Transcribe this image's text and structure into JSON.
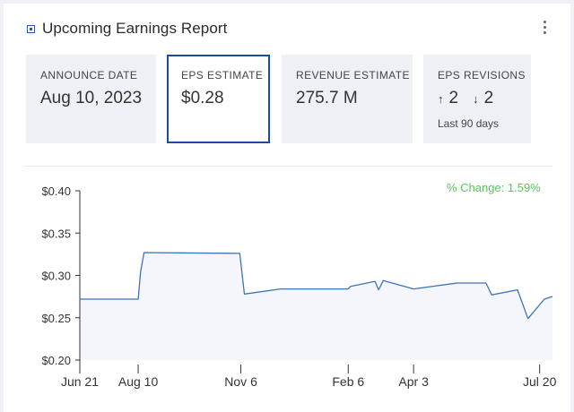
{
  "header": {
    "title": "Upcoming Earnings Report",
    "logo_icon": "square-logo-icon",
    "menu_icon": "kebab-menu-icon"
  },
  "tiles": {
    "announce": {
      "label": "ANNOUNCE DATE",
      "value": "Aug 10, 2023"
    },
    "eps": {
      "label": "EPS ESTIMATE",
      "value": "$0.28"
    },
    "revenue": {
      "label": "REVENUE ESTIMATE",
      "value": "275.7 M"
    },
    "revisions": {
      "label": "EPS REVISIONS",
      "up_arrow": "↑",
      "up": "2",
      "down_arrow": "↓",
      "down": "2",
      "period": "Last 90 days"
    }
  },
  "chart": {
    "change_label": "% Change: 1.59%"
  },
  "colors": {
    "accent": "#1c4c9c",
    "line": "#3d74b3",
    "fill": "#f4f6fc",
    "positive": "#5bc35b"
  },
  "chart_data": {
    "type": "area",
    "title": "",
    "xlabel": "",
    "ylabel": "",
    "ylim": [
      0.2,
      0.4
    ],
    "yticks": [
      "$0.40",
      "$0.35",
      "$0.30",
      "$0.25",
      "$0.20"
    ],
    "ytick_values": [
      0.4,
      0.35,
      0.3,
      0.25,
      0.2
    ],
    "xticks": [
      "Jun 21",
      "Aug 10",
      "Nov 6",
      "Feb 6",
      "Apr 3",
      "Jul 20"
    ],
    "xtick_values": [
      "2022-06-21",
      "2022-08-10",
      "2022-11-06",
      "2023-02-06",
      "2023-04-03",
      "2023-07-20"
    ],
    "x_range": [
      "2022-06-21",
      "2023-07-31"
    ],
    "series": [
      {
        "x": [
          "2022-06-21",
          "2022-08-10",
          "2022-08-12",
          "2022-08-15",
          "2022-11-05",
          "2022-11-09",
          "2022-12-10",
          "2023-02-06",
          "2023-02-08",
          "2023-03-01",
          "2023-03-04",
          "2023-03-08",
          "2023-04-03",
          "2023-05-10",
          "2023-06-04",
          "2023-06-09",
          "2023-07-01",
          "2023-07-10",
          "2023-07-24",
          "2023-07-31"
        ],
        "y": [
          0.272,
          0.272,
          0.304,
          0.327,
          0.326,
          0.278,
          0.284,
          0.284,
          0.287,
          0.293,
          0.283,
          0.294,
          0.284,
          0.291,
          0.291,
          0.277,
          0.283,
          0.249,
          0.272,
          0.275
        ]
      }
    ]
  }
}
